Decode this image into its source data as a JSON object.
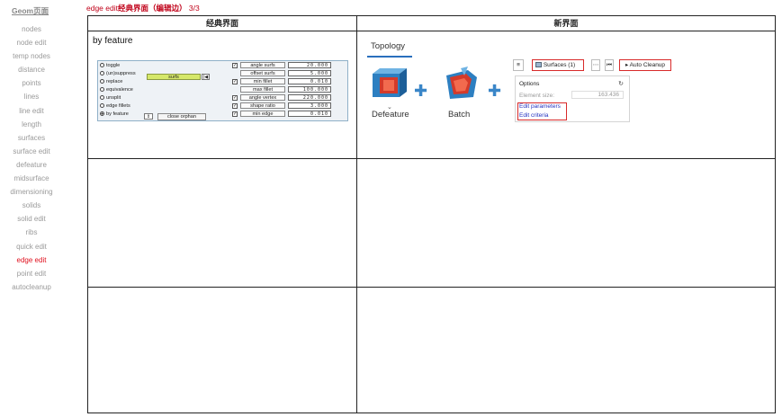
{
  "nav": {
    "title": "Geom页面",
    "items": [
      "nodes",
      "node edit",
      "temp nodes",
      "distance",
      "points",
      "lines",
      "line edit",
      "length",
      "surfaces",
      "surface edit",
      "defeature",
      "midsurface",
      "dimensioning",
      "solids",
      "solid edit",
      "ribs",
      "quick edit",
      "edge edit",
      "point edit",
      "autocleanup"
    ],
    "active": "edge edit"
  },
  "page": {
    "title_prefix": "edge edit",
    "title_bold": "经典界面（编辑边）",
    "title_suffix": " 3/3"
  },
  "table": {
    "header_left": "经典界面",
    "header_right": "新界面",
    "cell_title": "by feature"
  },
  "classic": {
    "radios": [
      "toggle",
      "(un)suppress",
      "replace",
      "equivalence",
      "unsplit",
      "edge fillets",
      "by feature"
    ],
    "selected_radio": "by feature",
    "surfs": "surfs",
    "play_glyph": "|◀",
    "params": [
      {
        "label": "angle surfs",
        "value": "20.000",
        "checked": true
      },
      {
        "label": "offset surfs",
        "value": "5.000",
        "checked": false
      },
      {
        "label": "min fillet",
        "value": "0.010",
        "checked": true
      },
      {
        "label": "max fillet",
        "value": "100.000",
        "checked": false
      },
      {
        "label": "angle vertex",
        "value": "220.000",
        "checked": true
      },
      {
        "label": "shape ratio",
        "value": "3.000",
        "checked": true
      },
      {
        "label": "min edge",
        "value": "0.010",
        "checked": true
      }
    ],
    "check_glyph": "✓",
    "by_feature_select": "⇕",
    "close_orphan": "close orphan"
  },
  "new_ui": {
    "tab": "Topology",
    "tools": [
      {
        "label": "Defeature",
        "icon": "defeature-icon"
      },
      {
        "label": "Batch",
        "icon": "batch-icon"
      }
    ],
    "plus_glyph": "✚",
    "chevron_glyph": "⌄",
    "toolbar": {
      "menu_glyph": "≡",
      "surfaces": "Surfaces (1)",
      "more_glyph": "⋯",
      "step_glyph": "⏮",
      "auto_cleanup": "▸ Auto Cleanup"
    },
    "options": {
      "title": "Options",
      "refresh_glyph": "↻",
      "element_size_label": "Element size:",
      "element_size_value": "163.436",
      "edit_parameters": "Edit parameters",
      "edit_criteria": "Edit criteria"
    }
  },
  "colors": {
    "active_nav": "#e0101e",
    "title": "#c00018",
    "accent_blue": "#2a6fbd",
    "highlight_red": "#d82a2a",
    "surfs_yellow": "#d6e86a"
  }
}
